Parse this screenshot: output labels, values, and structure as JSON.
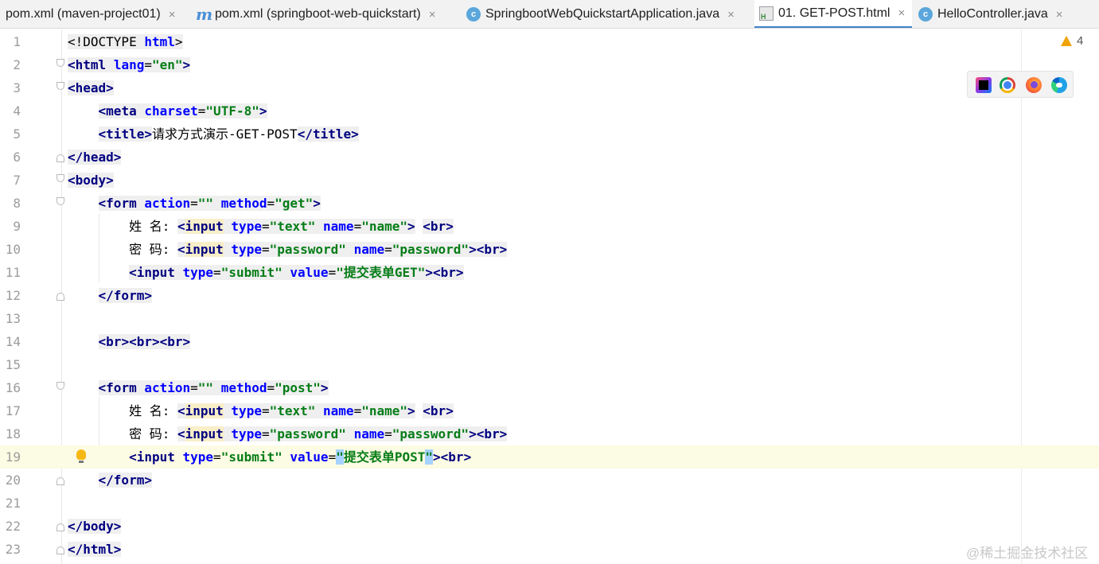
{
  "tabs": [
    {
      "label": "pom.xml (maven-project01)",
      "icon": "none",
      "active": false
    },
    {
      "label": "pom.xml (springboot-web-quickstart)",
      "icon": "maven-icon",
      "active": false
    },
    {
      "label": "SpringbootWebQuickstartApplication.java",
      "icon": "spring-class-icon",
      "active": false
    },
    {
      "label": "01. GET-POST.html",
      "icon": "html-file-icon",
      "active": true
    },
    {
      "label": "HelloController.java",
      "icon": "class-icon",
      "active": false
    }
  ],
  "tab_close_glyph": "×",
  "maven_glyph": "m",
  "class_glyph": "c",
  "warnings_count": "4",
  "code": {
    "doctype": "<!DOCTYPE ",
    "doctype_html": "html",
    "html_open": "html",
    "lang_attr": "lang",
    "lang_val": "\"en\"",
    "head": "head",
    "meta": "meta",
    "charset_attr": "charset",
    "charset_val": "\"UTF-8\"",
    "title": "title",
    "title_text": "请求方式演示-GET-POST",
    "body": "body",
    "form": "form",
    "action_attr": "action",
    "action_val": "\"\"",
    "method_attr": "method",
    "method_get": "\"get\"",
    "method_post": "\"post\"",
    "label_name": "姓 名: ",
    "label_pwd": "密 码: ",
    "input": "input",
    "type_attr": "type",
    "type_text": "\"text\"",
    "type_password": "\"password\"",
    "type_submit": "\"submit\"",
    "name_attr": "name",
    "name_name": "\"name\"",
    "name_password": "\"password\"",
    "value_attr": "value",
    "value_get": "\"提交表单GET\"",
    "value_post_text": "提交表单POST",
    "quote": "\"",
    "br": "br"
  },
  "line_numbers": [
    "1",
    "2",
    "3",
    "4",
    "5",
    "6",
    "7",
    "8",
    "9",
    "10",
    "11",
    "12",
    "13",
    "14",
    "15",
    "16",
    "17",
    "18",
    "19",
    "20",
    "21",
    "22",
    "23"
  ],
  "watermark": "@稀土掘金技术社区"
}
